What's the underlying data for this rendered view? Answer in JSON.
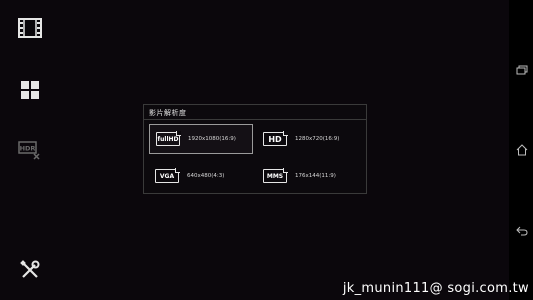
{
  "dialog": {
    "title": "影片解析度",
    "options": [
      {
        "badge": "fullHD",
        "label": "1920x1080(16:9)",
        "selected": true
      },
      {
        "badge": "HD",
        "label": "1280x720(16:9)",
        "selected": false
      },
      {
        "badge": "VGA",
        "label": "640x480(4:3)",
        "selected": false
      },
      {
        "badge": "MMS",
        "label": "176x144(11:9)",
        "selected": false
      }
    ]
  },
  "sidebar": {
    "icons": [
      "film-icon",
      "grid-icon",
      "hdr-off-icon",
      "tools-icon"
    ],
    "hdr_label": "HDR"
  },
  "navbar": {
    "icons": [
      "recent-apps-icon",
      "home-icon",
      "back-icon"
    ]
  },
  "watermark": "jk_munin111@ sogi.com.tw",
  "colors": {
    "background": "#0b070c",
    "dialog_border": "#3a3a3a",
    "selected_border": "#9a9a9a",
    "text": "#d8d8d8"
  }
}
